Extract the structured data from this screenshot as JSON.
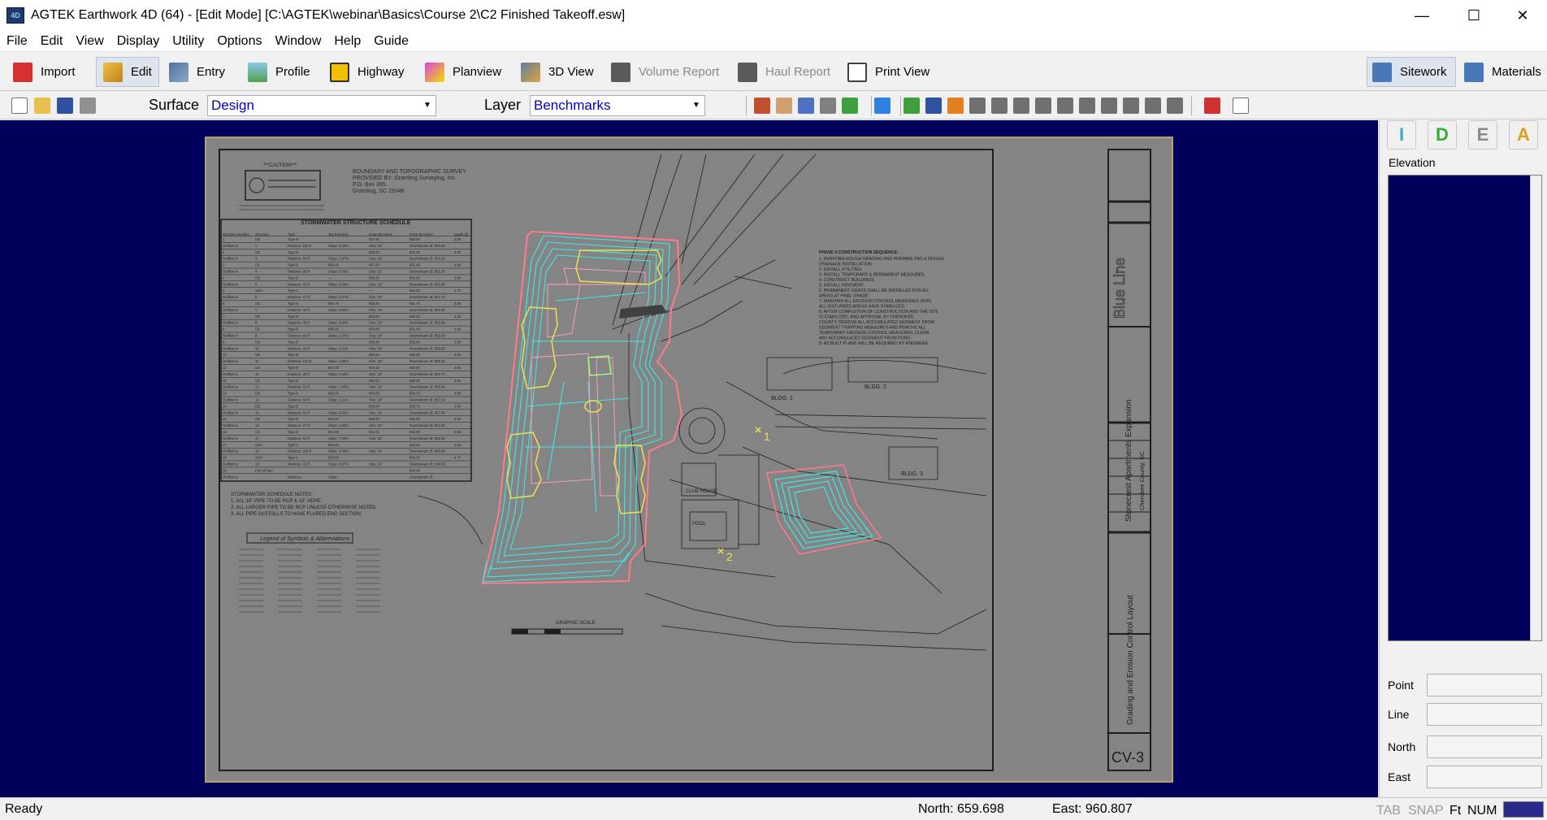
{
  "window": {
    "title": "AGTEK Earthwork 4D (64) - [Edit Mode]  [C:\\AGTEK\\webinar\\Basics\\Course 2\\C2 Finished Takeoff.esw]",
    "app_icon_text": "4D",
    "minimize": "—",
    "maximize": "☐",
    "close": "✕"
  },
  "menu": [
    "File",
    "Edit",
    "View",
    "Display",
    "Utility",
    "Options",
    "Window",
    "Help",
    "Guide"
  ],
  "main_toolbar": {
    "import": "Import",
    "edit": "Edit",
    "entry": "Entry",
    "profile": "Profile",
    "highway": "Highway",
    "planview": "Planview",
    "view3d": "3D View",
    "volume_report": "Volume Report",
    "haul_report": "Haul Report",
    "print_view": "Print View",
    "sitework": "Sitework",
    "materials": "Materials"
  },
  "surface": {
    "label": "Surface",
    "value": "Design"
  },
  "layer": {
    "label": "Layer",
    "value": "Benchmarks"
  },
  "right_panel": {
    "idea_buttons": [
      "I",
      "D",
      "E",
      "A"
    ],
    "elevation_label": "Elevation",
    "fields": {
      "point": "Point",
      "line": "Line",
      "north": "North",
      "east": "East"
    }
  },
  "drawing": {
    "caution_title": "***CAUTION***",
    "survey_lines": [
      "BOUNDARY AND TOPOGRAPHIC SURVEY",
      "PROVIDED BY: Gramling Surveying, Inc.",
      "P.O. Box 365",
      "Gramling, SC 29348"
    ],
    "schedule_title": "STORMWATER STRUCTURE SCHEDULE",
    "schedule_cols": [
      "Structure Number",
      "Structure",
      "Type",
      "Top Elevation",
      "Grate Elevation",
      "Invert Elevation",
      "Depth (ft)"
    ],
    "schedule_rows": [
      [
        "1",
        "CB",
        "Type B",
        "",
        "857.00",
        "850.00",
        "3.00"
      ],
      [
        "Outflow to",
        "2",
        "Distance: 104 ft",
        "Slope: 0.46%",
        "Size: 18\"",
        "Downstream IE: 854.60",
        ""
      ],
      [
        "2",
        "CB",
        "Type B",
        "",
        "855.00",
        "852.00",
        "3.00"
      ],
      [
        "Outflow to",
        "3",
        "Distance: 94 ft",
        "Slope: 1.07%",
        "Size: 18\"",
        "Downstream IE: 853.10",
        ""
      ],
      [
        "3",
        "CB",
        "Type D",
        "856.00",
        "857.00",
        "852.00",
        "4.00"
      ],
      [
        "Outflow to",
        "4",
        "Distance: 65 ft",
        "Slope: 0.50%",
        "Size: 15\"",
        "Downstream IE: 852.20",
        ""
      ],
      [
        "4",
        "CB",
        "Type B",
        "—",
        "855.00",
        "852.20",
        "3.00"
      ],
      [
        "Outflow to",
        "5",
        "Distance: 63 ft",
        "Slope: 0.56%",
        "Size: 15\"",
        "Downstream IE: 852.80",
        ""
      ],
      [
        "5",
        "SSH",
        "Type C",
        "—",
        "—",
        "852.20",
        "4.72"
      ],
      [
        "Outflow to",
        "6",
        "Distance: 47 ft",
        "Slope: 0.57%",
        "Size: 15\"",
        "Downstream IE: 851.70",
        ""
      ],
      [
        "6",
        "CB",
        "Type D",
        "855.70",
        "855.20",
        "851.70",
        "3.50"
      ],
      [
        "Outflow to",
        "7",
        "Distance: 42 ft",
        "Slope: 0.52%",
        "Size: 15\"",
        "Downstream IE: 851.30",
        ""
      ],
      [
        "7",
        "CB",
        "Type B",
        "",
        "853.00",
        "850.40",
        "3.20"
      ],
      [
        "Outflow to",
        "8",
        "Distance: 48 ft",
        "Slope: 0.90%",
        "Size: 15\"",
        "Downstream IE: 852.30",
        ""
      ],
      [
        "8",
        "CB",
        "Type D",
        "855.40",
        "854.00",
        "851.00",
        "3.40"
      ],
      [
        "Outflow to",
        "9",
        "Distance: 94 ft",
        "Slope: 1.07%",
        "Size: 18\"",
        "Downstream IE: 850.00",
        ""
      ],
      [
        "9",
        "CB",
        "Type B",
        "",
        "855.00",
        "850.00",
        "3.00"
      ],
      [
        "Outflow to",
        "10",
        "Distance: 58 ft",
        "Slope: 0.52%",
        "Size: 18\"",
        "Downstream IE: 850.50",
        ""
      ],
      [
        "10",
        "CB",
        "Type B",
        "",
        "853.00",
        "850.00",
        "3.00"
      ],
      [
        "Outflow to",
        "11",
        "Distance: 121 ft",
        "Slope: 1.59%",
        "Size: 18\"",
        "Downstream IE: 855.20",
        ""
      ],
      [
        "11",
        "CB",
        "Type D",
        "854.30",
        "853.00",
        "850.00",
        "3.00"
      ],
      [
        "Outflow to",
        "12",
        "Distance: 30 ft",
        "Slope: 0.60%",
        "Size: 18\"",
        "Downstream IE: 850.70",
        ""
      ],
      [
        "12",
        "CB",
        "Type B",
        "",
        "852.00",
        "850.00",
        "3.00"
      ],
      [
        "Outflow to",
        "13",
        "Distance: 31 ft",
        "Slope: 1.00%",
        "Size: 18\"",
        "Downstream IE: 855.40",
        ""
      ],
      [
        "13",
        "CB",
        "Type D",
        "855.00",
        "855.00",
        "850.70",
        "4.60"
      ],
      [
        "Outflow to",
        "14",
        "Distance: 54 ft",
        "Slope: 1.11%",
        "Size: 18\"",
        "Downstream IE: 857.10",
        ""
      ],
      [
        "14",
        "CB",
        "Type B",
        "",
        "856.00",
        "850.70",
        "3.00"
      ],
      [
        "Outflow to",
        "15",
        "Distance: 52 ft",
        "Slope: 0.59%",
        "Size: 18\"",
        "Downstream IE: 857.80",
        ""
      ],
      [
        "15",
        "CB",
        "Type B",
        "853.00",
        "855.00",
        "850.00",
        "3.00"
      ],
      [
        "Outflow to",
        "16",
        "Distance: 27 ft",
        "Slope: 4.09%",
        "Size: 24\"",
        "Downstream IE: 853.20",
        ""
      ],
      [
        "16",
        "CB",
        "Type D",
        "854.50",
        "854.00",
        "853.00",
        "3.00"
      ],
      [
        "Outflow to",
        "17",
        "Distance: 54 ft",
        "Slope: 7.00%",
        "Size: 24\"",
        "Downstream IE: 852.50",
        ""
      ],
      [
        "17",
        "SSH",
        "Type C",
        "855.50",
        "",
        "853.00",
        "3.00"
      ],
      [
        "Outflow to",
        "18",
        "Distance: 205 ft",
        "Slope: 4.38%",
        "Size: 24\"",
        "Downstream IE: 840.30",
        ""
      ],
      [
        "18",
        "SSH",
        "Type C",
        "850.00",
        "",
        "840.30",
        "9.70"
      ],
      [
        "Outflow to",
        "19",
        "Distance: 31 ft",
        "Slope: 0.97%",
        "Size: 24\"",
        "Downstream IE: 840.00",
        ""
      ],
      [
        "19",
        "End of Pipe",
        "",
        "",
        "",
        "840.00",
        ""
      ],
      [
        "Outflow to",
        "",
        "Distance: ",
        "Slope: ",
        "",
        "Downstream IE: ",
        ""
      ]
    ],
    "schedule_notes": [
      "STORMWATER SCHEDULE NOTES:",
      "1.  ALL 18\" PIPE TO BE RCP & 15\" HDPE.",
      "2.  ALL LARGER PIPE TO BE RCP UNLESS OTHERWISE NOTED.",
      "3.  ALL PIPE OUTFALLS TO HAVE FLARED END SECTION."
    ],
    "legend_title": "Legend of Symbols & Abbreviations",
    "phase_title": "PHASE II CONSTRUCTION SEQUENCE:",
    "phase_lines": [
      "1.  PERFORM ROUGH GRADING AND PREPARE PAD & ROUGH",
      "    DRAINAGE INSTALLATION.",
      "2.  INSTALL UTILITIES.",
      "3.  INSTALL TEMPORARY & PERMANENT MEASURES.",
      "4.  CONSTRUCT BUILDINGS.",
      "5.  INSTALL PAVEMENT.",
      "6.  PERMANENT GRASS SHALL BE INSTALLED FOR ALL",
      "    AREAS AT FINAL GRADE.",
      "7.  MAINTAIN ALL EROSION CONTROL MEASURES UNTIL",
      "    ALL DISTURBED AREAS HAVE STABILIZED.",
      "8.  AFTER COMPLETION OF CONSTRUCTION AND THE SITE",
      "    IS STABILIZED, AND APPROVAL BY CHEROKEE",
      "    COUNTY, REMOVE ALL ACCUMULATED SEDIMENT FROM",
      "    SEDIMENT TRAPPING MEASURES AND REMOVE ALL",
      "    TEMPORARY EROSION CONTROL MEASURES. CLEAN",
      "    ANY ACCUMULATED SEDIMENT FROM POND.",
      "9.  AS BUILT PLANS WILL BE REQUIRED BY ENGINEER."
    ],
    "bldg1": "BLDG. 1",
    "bldg2": "BLDG. 2",
    "bldg3": "BLDG. 3",
    "club_house": "CLUB HOUSE",
    "pool": "POOL",
    "marker1": "1",
    "marker2": "2",
    "graphic_scale": "GRAPHIC SCALE",
    "project_name": "Stonecrest Apartments Expansion",
    "project_location": "Cherokee County, SC",
    "sheet_title": "Grading and Erosion Control Layout",
    "sheet_number": "CV-3",
    "firm_name": "Blue Line"
  },
  "status": {
    "ready": "Ready",
    "north": "North: 659.698",
    "east": "East: 960.807",
    "tab": "TAB",
    "snap": "SNAP",
    "ft": "Ft",
    "num": "NUM"
  },
  "colors": {
    "canvas_bg": "#00005a",
    "sheet_bg": "#848484",
    "boundary": "#ff7a8a",
    "contours": "#3ee6e6",
    "buildings": "#f0e050",
    "linework": "#1e1e1e"
  }
}
